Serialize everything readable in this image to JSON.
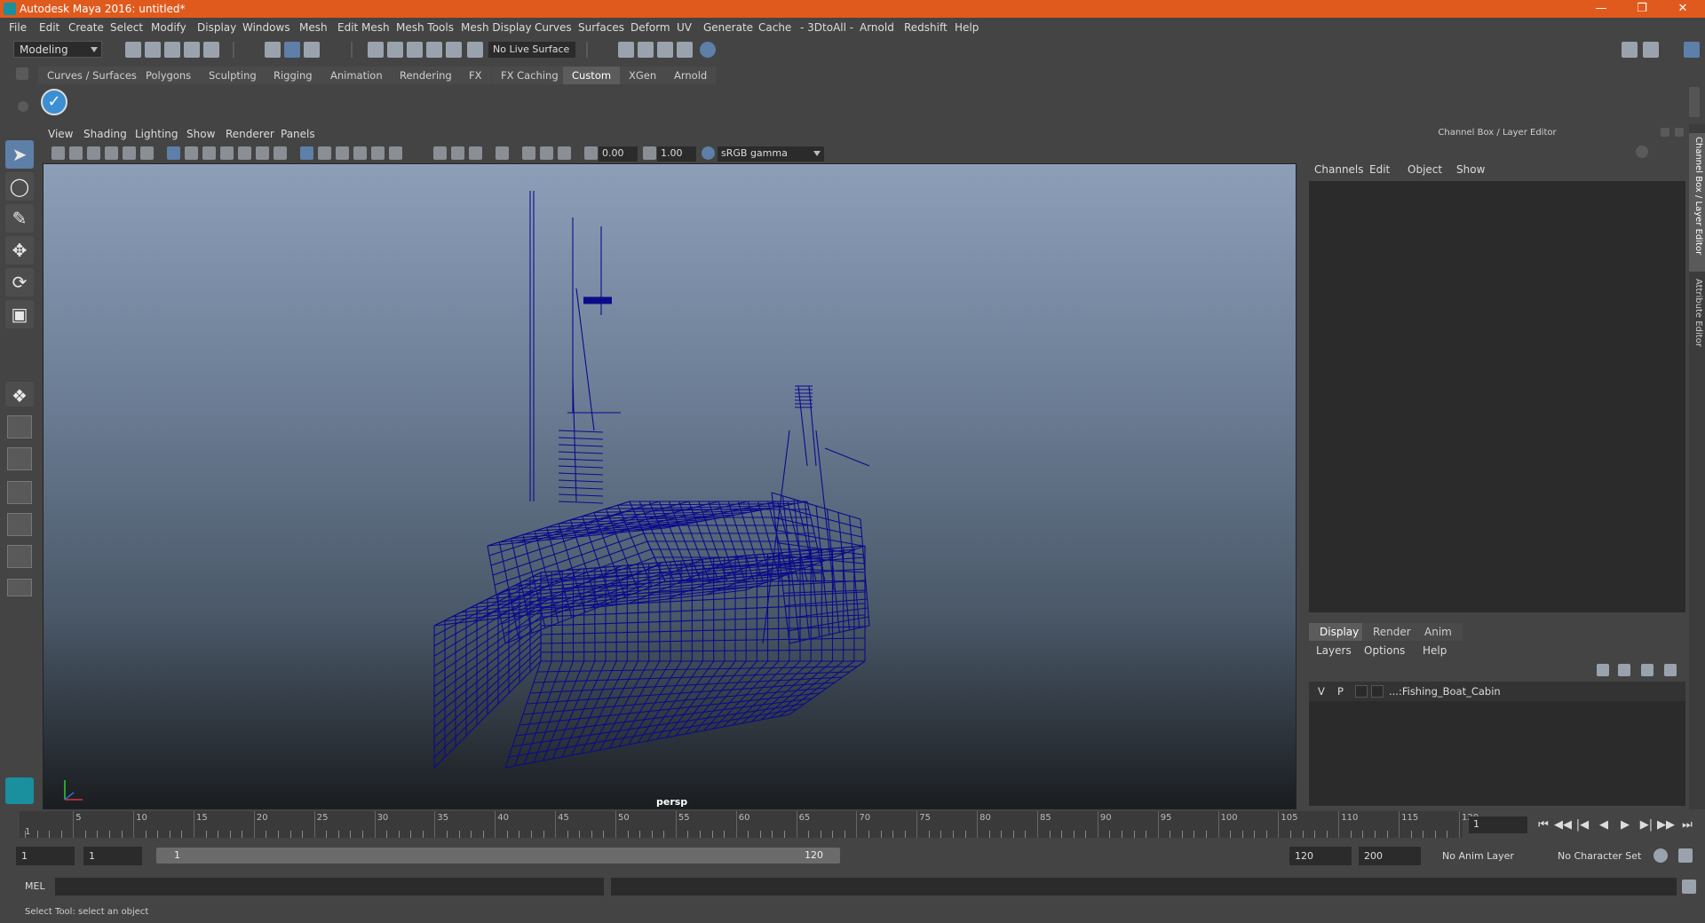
{
  "window": {
    "title": "Autodesk Maya 2016: untitled*"
  },
  "menubar": [
    "File",
    "Edit",
    "Create",
    "Select",
    "Modify",
    "Display",
    "Windows",
    "Mesh",
    "Edit Mesh",
    "Mesh Tools",
    "Mesh Display",
    "Curves",
    "Surfaces",
    "Deform",
    "UV",
    "Generate",
    "Cache",
    "- 3DtoAll -",
    "Arnold",
    "Redshift",
    "Help"
  ],
  "statusline": {
    "mode": "Modeling",
    "live_surface": "No Live Surface"
  },
  "shelf": {
    "tabs": [
      "Curves / Surfaces",
      "Polygons",
      "Sculpting",
      "Rigging",
      "Animation",
      "Rendering",
      "FX",
      "FX Caching",
      "Custom",
      "XGen",
      "Arnold"
    ],
    "active": "Custom"
  },
  "viewport": {
    "menu": [
      "View",
      "Shading",
      "Lighting",
      "Show",
      "Renderer",
      "Panels"
    ],
    "exposure": "0.00",
    "gamma": "1.00",
    "colorspace": "sRGB gamma",
    "camera": "persp",
    "wire_color": "#0b0b8a"
  },
  "channelbox": {
    "title": "Channel Box / Layer Editor",
    "menu": [
      "Channels",
      "Edit",
      "Object",
      "Show"
    ],
    "tabs": [
      "Display",
      "Render",
      "Anim"
    ],
    "active_tab": "Display",
    "layer_menu": [
      "Layers",
      "Options",
      "Help"
    ],
    "layers": [
      {
        "v": "V",
        "p": "P",
        "name": "...:Fishing_Boat_Cabin"
      }
    ]
  },
  "sidetabs": [
    "Channel Box / Layer Editor",
    "Attribute Editor"
  ],
  "timeline": {
    "labels": [
      "5",
      "10",
      "15",
      "20",
      "25",
      "30",
      "35",
      "40",
      "45",
      "50",
      "55",
      "60",
      "65",
      "70",
      "75",
      "80",
      "85",
      "90",
      "95",
      "100",
      "105",
      "110",
      "115",
      "120"
    ],
    "start_label": "1",
    "current_frame": "1"
  },
  "range": {
    "start": "1",
    "playback_start": "1",
    "bar_start": "1",
    "bar_end": "120",
    "playback_end": "120",
    "end": "200",
    "anim_layer": "No Anim Layer",
    "character_set": "No Character Set"
  },
  "cmdline": {
    "label": "MEL"
  },
  "helpline": {
    "text": "Select Tool: select an object"
  }
}
